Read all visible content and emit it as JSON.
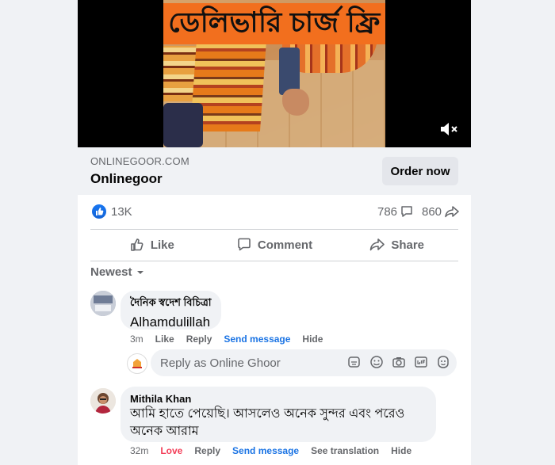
{
  "video": {
    "banner_text": "ডেলিভারি চার্জ ফ্রি",
    "mute_icon": "speaker-muted-icon"
  },
  "link": {
    "domain": "ONLINEGOOR.COM",
    "title": "Onlinegoor",
    "cta_label": "Order now"
  },
  "stats": {
    "likes": "13K",
    "comments": "786",
    "shares": "860"
  },
  "actions": {
    "like": "Like",
    "comment": "Comment",
    "share": "Share"
  },
  "sort": {
    "label": "Newest"
  },
  "comments": [
    {
      "author": "দৈনিক স্বদেশ বিচিত্রা",
      "text": "Alhamdulillah",
      "time": "3m",
      "actions": [
        "Like",
        "Reply",
        "Send message",
        "Hide"
      ]
    },
    {
      "author": "Mithila Khan",
      "text_line1": "আমি হাতে পেয়েছি। আসলেও অনেক সুন্দর এবং পরেও",
      "text_line2": "অনেক আরাম",
      "time": "32m",
      "actions": [
        "Love",
        "Reply",
        "Send message",
        "See translation",
        "Hide"
      ]
    }
  ],
  "reply": {
    "placeholder": "Reply as Online Ghoor",
    "icons": [
      "sticker-icon",
      "emoji-icon",
      "camera-icon",
      "gif-icon",
      "avatar-sticker-icon"
    ]
  },
  "colors": {
    "brand_blue": "#1b74e4",
    "love_red": "#f33e58",
    "banner_orange": "#f26f1e"
  }
}
